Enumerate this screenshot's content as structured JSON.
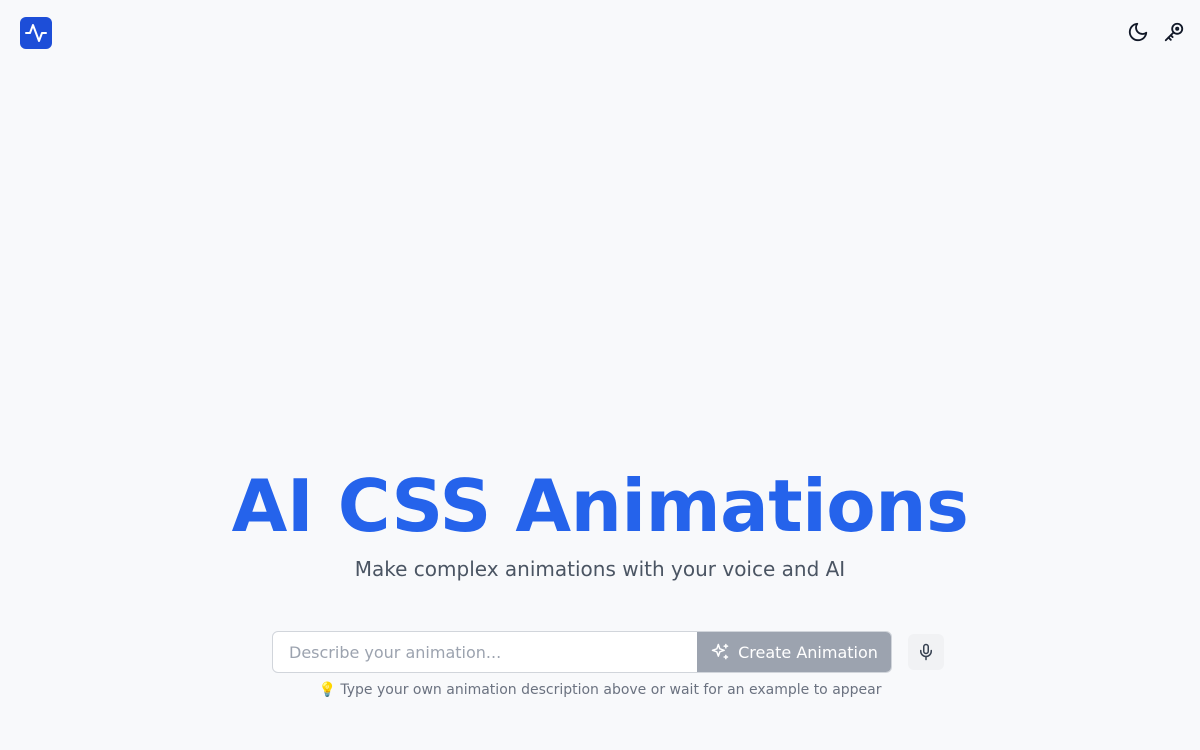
{
  "header": {
    "logo_icon": "activity-pulse-icon",
    "actions": [
      {
        "icon": "moon-icon"
      },
      {
        "icon": "key-icon"
      }
    ]
  },
  "hero": {
    "title": "AI CSS Animations",
    "subtitle": "Make complex animations with your voice and AI"
  },
  "prompt": {
    "value": "",
    "placeholder": "Describe your animation...",
    "create_label": "Create Animation",
    "create_icon": "sparkles-icon",
    "mic_icon": "microphone-icon"
  },
  "hint": {
    "emoji": "💡",
    "text": "Type your own animation description above or wait for an example to appear"
  },
  "colors": {
    "background": "#f8f9fb",
    "brand": "#2563eb",
    "logo_bg": "#1d4ed8",
    "button_disabled": "#9ca3af"
  }
}
